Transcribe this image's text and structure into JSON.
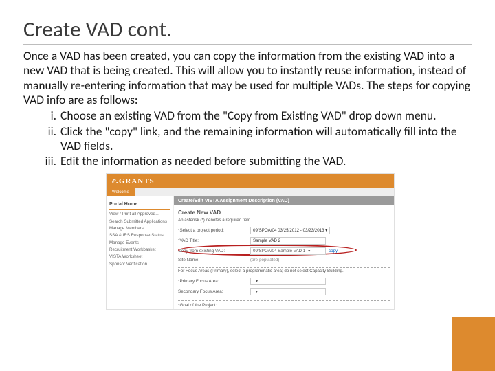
{
  "title": "Create VAD cont.",
  "intro": "Once a VAD has been created, you can copy the information from the existing VAD into a new VAD that is being created. This will allow you to instantly reuse information, instead of manually re-entering information that may be used for multiple VADs. The steps for copying VAD info are as follows:",
  "steps": [
    "Choose an existing VAD from the \"Copy from Existing VAD\" drop down menu.",
    "Click the \"copy\" link, and the remaining information will automatically fill into the VAD fields.",
    "Edit the information as needed before submitting the VAD."
  ],
  "shot": {
    "brand_e": "e.",
    "brand_rest": "GRANTS",
    "tabs": {
      "active": "Welcome",
      "other": ""
    },
    "sidebar": {
      "head": "Portal Home",
      "items": [
        "View / Print all Approved…",
        "Search Submitted Applications",
        "Manage Members",
        "SSA & IRS Response Status",
        "Manage Events",
        "Recruitment Workbasket",
        "VISTA Worksheet",
        "Sponsor Verification"
      ]
    },
    "main": {
      "bar": "Create/Edit VISTA Assignment Description (VAD)",
      "section": "Create New VAD",
      "note": "An asterisk (*) denotes a required field",
      "rows": {
        "period_lbl": "*Select a project period:",
        "period_val": "09/SPOA/04   03/25/2012 - 03/23/2013 ▾",
        "title_lbl": "*VAD Title:",
        "title_val": "Sample VAD 2",
        "copy_lbl": "Copy from existing VAD:",
        "copy_val": "09/SPOA/04 Sample VAD 1",
        "copy_link": "copy",
        "site_lbl": "Site Name:",
        "site_val": "(pre-populated)",
        "focus_note": "For Focus Areas (Primary), select a programmatic area; do not select Capacity Building.",
        "primary_lbl": "*Primary Focus Area:",
        "secondary_lbl": "Secondary Focus Area:",
        "goal_lbl": "*Goal of the Project:"
      }
    }
  }
}
